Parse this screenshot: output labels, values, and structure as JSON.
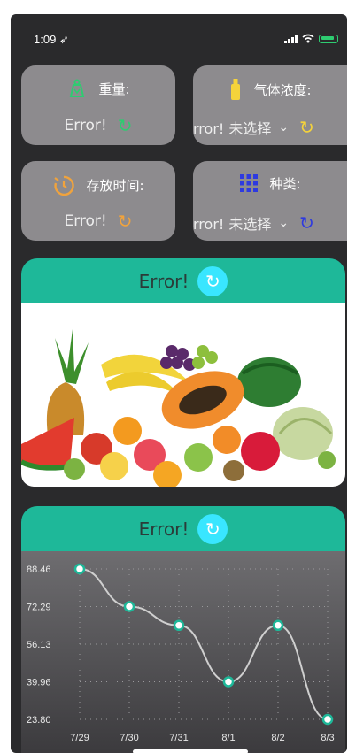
{
  "status": {
    "time": "1:09 ➶"
  },
  "cards": {
    "weight": {
      "label": "重量:",
      "value": "Error!"
    },
    "gas": {
      "label": "气体浓度:",
      "value": "rror! 未选择"
    },
    "time": {
      "label": "存放时间:",
      "value": "Error!"
    },
    "type": {
      "label": "种类:",
      "value": "rror! 未选择"
    }
  },
  "fruit_section": {
    "title": "Error!"
  },
  "chart_section": {
    "title": "Error!"
  },
  "chart_data": {
    "type": "line",
    "x": [
      "7/29",
      "7/30",
      "7/31",
      "8/1",
      "8/2",
      "8/3"
    ],
    "values": [
      88.46,
      72.29,
      64.2,
      39.96,
      64.2,
      23.8
    ],
    "y_ticks": [
      "88.46",
      "72.29",
      "56.13",
      "39.96",
      "23.80"
    ],
    "ylim": [
      23.8,
      88.46
    ],
    "grid": true,
    "line_color": "#cfcfcf",
    "point_color": "#1eb899"
  },
  "colors": {
    "teal": "#1eb899",
    "cyan": "#39e6ff",
    "card": "#8d8b8e",
    "green_icon": "#2ecc71",
    "yellow_icon": "#f5d33b",
    "orange_icon": "#f0a33d",
    "blue_icon": "#2e3ae0"
  }
}
